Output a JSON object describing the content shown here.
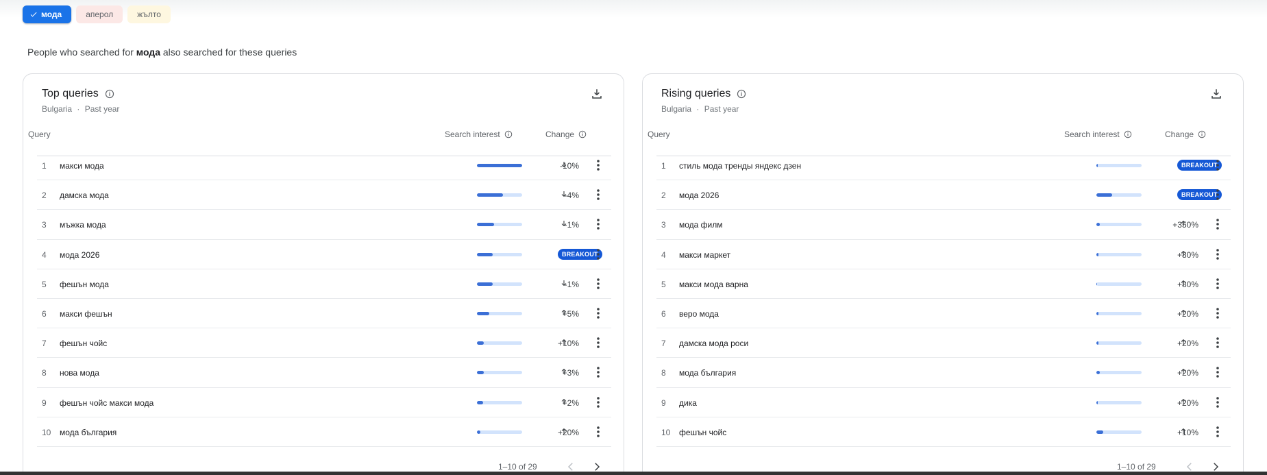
{
  "chips": [
    {
      "label": "мода",
      "active": true,
      "color": "#1a73e8"
    },
    {
      "label": "аперол",
      "active": false,
      "color": "#fce8e6"
    },
    {
      "label": "жълто",
      "active": false,
      "color": "#fef7e0"
    }
  ],
  "intro": {
    "before": "People who searched for",
    "term": "мода",
    "after": "also searched for these queries"
  },
  "columns": {
    "query": "Query",
    "interest": "Search interest",
    "change": "Change"
  },
  "top": {
    "title": "Top queries",
    "region": "Bulgaria",
    "separator": "·",
    "period": "Past year",
    "pager": "1–10 of 29",
    "rows": [
      {
        "rank": "1",
        "query": "макси мода",
        "interest": 100,
        "direction": "down",
        "change": "-10%"
      },
      {
        "rank": "2",
        "query": "дамска мода",
        "interest": 58,
        "direction": "down",
        "change": "-4%"
      },
      {
        "rank": "3",
        "query": "мъжка мода",
        "interest": 38,
        "direction": "down",
        "change": "-1%"
      },
      {
        "rank": "4",
        "query": "мода 2026",
        "interest": 35,
        "direction": "breakout",
        "change": "BREAKOUT"
      },
      {
        "rank": "5",
        "query": "фешън мода",
        "interest": 35,
        "direction": "down",
        "change": "-1%"
      },
      {
        "rank": "6",
        "query": "макси фешън",
        "interest": 27,
        "direction": "up",
        "change": "+5%"
      },
      {
        "rank": "7",
        "query": "фешън чойс",
        "interest": 15,
        "direction": "up",
        "change": "+10%"
      },
      {
        "rank": "8",
        "query": "нова мода",
        "interest": 15,
        "direction": "up",
        "change": "+3%"
      },
      {
        "rank": "9",
        "query": "фешън чойс макси мода",
        "interest": 13,
        "direction": "up",
        "change": "+2%"
      },
      {
        "rank": "10",
        "query": "мода българия",
        "interest": 8,
        "direction": "up",
        "change": "+20%"
      }
    ]
  },
  "rising": {
    "title": "Rising queries",
    "region": "Bulgaria",
    "separator": "·",
    "period": "Past year",
    "pager": "1–10 of 29",
    "rows": [
      {
        "rank": "1",
        "query": "стиль мода тренды яндекс дзен",
        "interest": 3,
        "direction": "breakout",
        "change": "BREAKOUT"
      },
      {
        "rank": "2",
        "query": "мода 2026",
        "interest": 35,
        "direction": "breakout",
        "change": "BREAKOUT"
      },
      {
        "rank": "3",
        "query": "мода филм",
        "interest": 8,
        "direction": "up",
        "change": "+350%"
      },
      {
        "rank": "4",
        "query": "макси маркет",
        "interest": 4,
        "direction": "up",
        "change": "+80%"
      },
      {
        "rank": "5",
        "query": "макси мода варна",
        "interest": 2,
        "direction": "up",
        "change": "+80%"
      },
      {
        "rank": "6",
        "query": "веро мода",
        "interest": 4,
        "direction": "up",
        "change": "+20%"
      },
      {
        "rank": "7",
        "query": "дамска мода роси",
        "interest": 4,
        "direction": "up",
        "change": "+20%"
      },
      {
        "rank": "8",
        "query": "мода българия",
        "interest": 8,
        "direction": "up",
        "change": "+20%"
      },
      {
        "rank": "9",
        "query": "дика",
        "interest": 3,
        "direction": "up",
        "change": "+20%"
      },
      {
        "rank": "10",
        "query": "фешън чойс",
        "interest": 15,
        "direction": "up",
        "change": "+10%"
      }
    ]
  },
  "icons": {
    "info": "info-icon",
    "download": "download-icon",
    "more": "more-vert-icon",
    "up": "arrow-up-icon",
    "down": "arrow-down-icon",
    "prev": "chevron-left-icon",
    "next": "chevron-right-icon",
    "check": "check-icon"
  },
  "colors": {
    "accent": "#1a73e8",
    "bar_fill": "#3b6fd6",
    "bar_track": "#d2e3fc",
    "breakout": "#1558d6"
  }
}
